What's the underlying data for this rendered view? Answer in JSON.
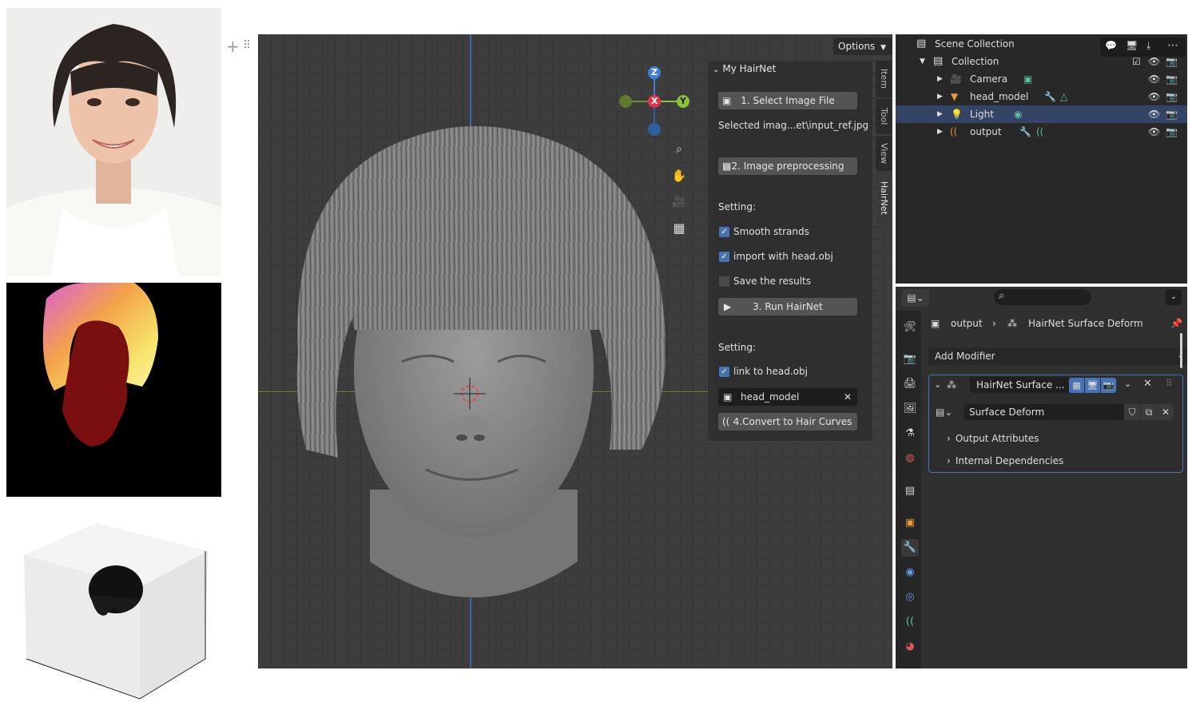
{
  "viewport": {
    "options_label": "Options",
    "gizmo": {
      "z": "Z",
      "x": "X",
      "y": "Y"
    },
    "sidebar_tabs": [
      "Item",
      "Tool",
      "View",
      "HairNet"
    ]
  },
  "hairnet_panel": {
    "title": "My HairNet",
    "select_image_button": "1. Select Image File",
    "selected_image_text": "Selected imag...et\\input_ref.jpg",
    "preprocess_button": "2. Image preprocessing",
    "setting1_label": "Setting:",
    "smooth_strands": {
      "label": "Smooth strands",
      "checked": true
    },
    "import_head": {
      "label": "import with head.obj",
      "checked": true
    },
    "save_results": {
      "label": "Save the results",
      "checked": false
    },
    "run_button": "3. Run HairNet",
    "setting2_label": "Setting:",
    "link_head": {
      "label": "link to head.obj",
      "checked": true
    },
    "head_field": "head_model",
    "convert_button": "4.Convert to Hair Curves"
  },
  "outliner": {
    "scene_collection": "Scene Collection",
    "collection": "Collection",
    "items": [
      {
        "label": "Camera",
        "icon": "camera-icon"
      },
      {
        "label": "head_model",
        "icon": "mesh-icon"
      },
      {
        "label": "Light",
        "icon": "light-icon"
      },
      {
        "label": "output",
        "icon": "curves-icon"
      }
    ]
  },
  "properties": {
    "breadcrumb_object": "output",
    "breadcrumb_modifier": "HairNet Surface Deform",
    "add_modifier": "Add Modifier",
    "modifier_name": "HairNet Surface ...",
    "node_group": "Surface Deform",
    "output_attributes": "Output Attributes",
    "internal_dependencies": "Internal Dependencies"
  },
  "colors": {
    "selection": "#334466",
    "accent_blue": "#4772b3",
    "axis_x": "#e0344a",
    "axis_y": "#8ac13b",
    "axis_z": "#3f80d6"
  }
}
